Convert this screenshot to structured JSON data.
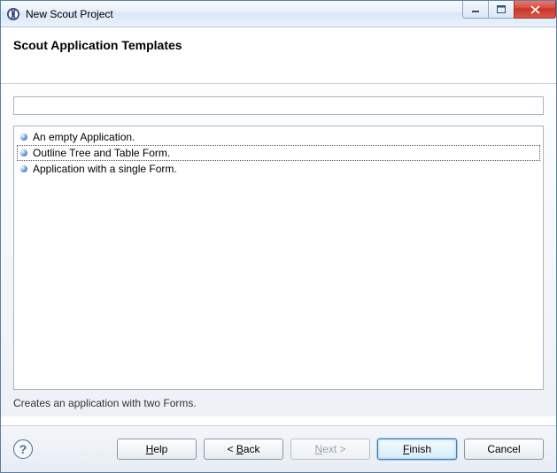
{
  "window": {
    "title": "New Scout Project"
  },
  "header": {
    "title": "Scout Application Templates"
  },
  "filter": {
    "value": "",
    "placeholder": ""
  },
  "templates": [
    {
      "label": "An empty Application.",
      "selected": false
    },
    {
      "label": "Outline Tree and Table Form.",
      "selected": true
    },
    {
      "label": "Application with a single Form.",
      "selected": false
    }
  ],
  "description": "Creates an application with two Forms.",
  "buttons": {
    "help": "Help",
    "back": "< Back",
    "next": "Next >",
    "finish": "Finish",
    "cancel": "Cancel",
    "next_enabled": false
  }
}
